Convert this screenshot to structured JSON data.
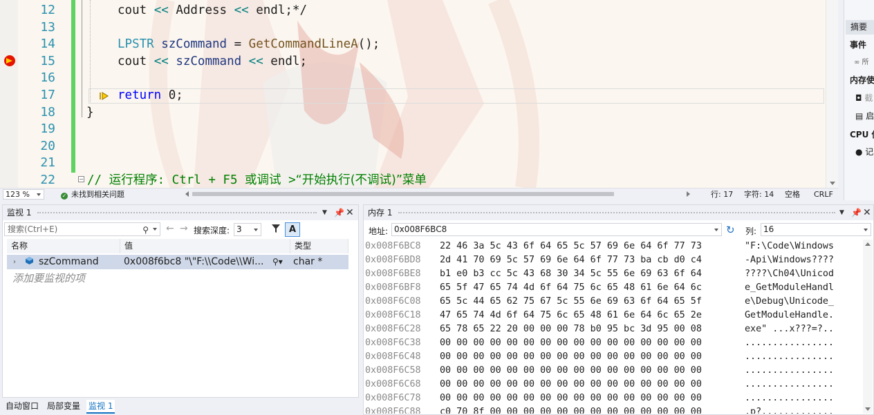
{
  "editor": {
    "lines": [
      {
        "num": "12",
        "code": "    cout << Address << endl;*/"
      },
      {
        "num": "13",
        "code": ""
      },
      {
        "num": "14",
        "code": "    LPSTR szCommand = GetCommandLineA();"
      },
      {
        "num": "15",
        "code": "    cout << szCommand << endl;"
      },
      {
        "num": "16",
        "code": ""
      },
      {
        "num": "17",
        "code": "    return 0;"
      },
      {
        "num": "18",
        "code": "}"
      },
      {
        "num": "19",
        "code": ""
      },
      {
        "num": "20",
        "code": ""
      },
      {
        "num": "21",
        "code": ""
      },
      {
        "num": "22",
        "code": "// 运行程序: Ctrl + F5 或调试 >“开始执行(不调试)”菜单"
      }
    ],
    "tokens": {
      "l12_cout": "cout",
      "l12_op1": " << ",
      "l12_addr": "Address",
      "l12_op2": " << ",
      "l12_endl": "endl",
      "l12_tail": ";*/",
      "l14_type": "LPSTR",
      "l14_var": " szCommand",
      "l14_eq": " = ",
      "l14_fn": "GetCommandLineA",
      "l14_tail": "();",
      "l15_cout": "cout",
      "l15_op1": " << ",
      "l15_var": "szCommand",
      "l15_op2": " << ",
      "l15_endl": "endl",
      "l15_tail": ";",
      "l17_kw": "return",
      "l17_tail": " 0;",
      "l18": "}",
      "l22_a": "// 运行程序: Ctrl + F5 ",
      "l22_b": "或调试",
      "l22_c": " >",
      "l22_d": "“开始执行(不调试)”菜单"
    },
    "breakpoint_line": "15",
    "current_line": "17",
    "colors": {
      "keyword": "#0000ff",
      "type": "#2b91af",
      "comment": "#008000",
      "change_bar": "#5fd35f",
      "breakpoint": "#e51400"
    }
  },
  "editor_status": {
    "zoom": "123 %",
    "issues": "未找到相关问题",
    "line": "行: 17",
    "char": "字符: 14",
    "whitespace": "空格",
    "eol": "CRLF"
  },
  "diagnostics": {
    "tab_summary": "摘要",
    "events": "事件",
    "events_item": "所",
    "memory_usage": "内存使",
    "mem_item1": "截",
    "mem_item2": "启",
    "cpu_usage": "CPU 使",
    "cpu_item": "记"
  },
  "watch": {
    "title": "监视 1",
    "search_placeholder": "搜索(Ctrl+E)",
    "search_depth_label": "搜索深度:",
    "search_depth": "3",
    "columns": [
      "名称",
      "值",
      "类型"
    ],
    "rows": [
      {
        "name": "szCommand",
        "value": "0x008f6bc8 \"\\\"F:\\\\Code\\\\Wi...",
        "type": "char *"
      }
    ],
    "add_placeholder": "添加要监视的项",
    "format_toggle": "A"
  },
  "bottom_tabs": [
    "自动窗口",
    "局部变量",
    "监视 1"
  ],
  "bottom_tabs_active": 2,
  "memory": {
    "title": "内存 1",
    "address_label": "地址:",
    "address": "0x008F6BC8",
    "columns_label": "列:",
    "columns": "16",
    "rows": [
      {
        "addr": "0x008F6BC8",
        "hex": "22 46 3a 5c 43 6f 64 65 5c 57 69 6e 64 6f 77 73",
        "ascii": "\"F:\\Code\\Windows"
      },
      {
        "addr": "0x008F6BD8",
        "hex": "2d 41 70 69 5c 57 69 6e 64 6f 77 73 ba cb d0 c4",
        "ascii": "-Api\\Windows????"
      },
      {
        "addr": "0x008F6BE8",
        "hex": "b1 e0 b3 cc 5c 43 68 30 34 5c 55 6e 69 63 6f 64",
        "ascii": "????\\Ch04\\Unicod"
      },
      {
        "addr": "0x008F6BF8",
        "hex": "65 5f 47 65 74 4d 6f 64 75 6c 65 48 61 6e 64 6c",
        "ascii": "e_GetModuleHandl"
      },
      {
        "addr": "0x008F6C08",
        "hex": "65 5c 44 65 62 75 67 5c 55 6e 69 63 6f 64 65 5f",
        "ascii": "e\\Debug\\Unicode_"
      },
      {
        "addr": "0x008F6C18",
        "hex": "47 65 74 4d 6f 64 75 6c 65 48 61 6e 64 6c 65 2e",
        "ascii": "GetModuleHandle."
      },
      {
        "addr": "0x008F6C28",
        "hex": "65 78 65 22 20 00 00 00 78 b0 95 bc 3d 95 00 08",
        "ascii": "exe\" ...x???=?.."
      },
      {
        "addr": "0x008F6C38",
        "hex": "00 00 00 00 00 00 00 00 00 00 00 00 00 00 00 00",
        "ascii": "................"
      },
      {
        "addr": "0x008F6C48",
        "hex": "00 00 00 00 00 00 00 00 00 00 00 00 00 00 00 00",
        "ascii": "................"
      },
      {
        "addr": "0x008F6C58",
        "hex": "00 00 00 00 00 00 00 00 00 00 00 00 00 00 00 00",
        "ascii": "................"
      },
      {
        "addr": "0x008F6C68",
        "hex": "00 00 00 00 00 00 00 00 00 00 00 00 00 00 00 00",
        "ascii": "................"
      },
      {
        "addr": "0x008F6C78",
        "hex": "00 00 00 00 00 00 00 00 00 00 00 00 00 00 00 00",
        "ascii": "................"
      },
      {
        "addr": "0x008F6C88",
        "hex": "c0 70 8f 00 00 00 00 00 00 00 00 00 00 00 00 00",
        "ascii": ".p?............."
      }
    ]
  }
}
